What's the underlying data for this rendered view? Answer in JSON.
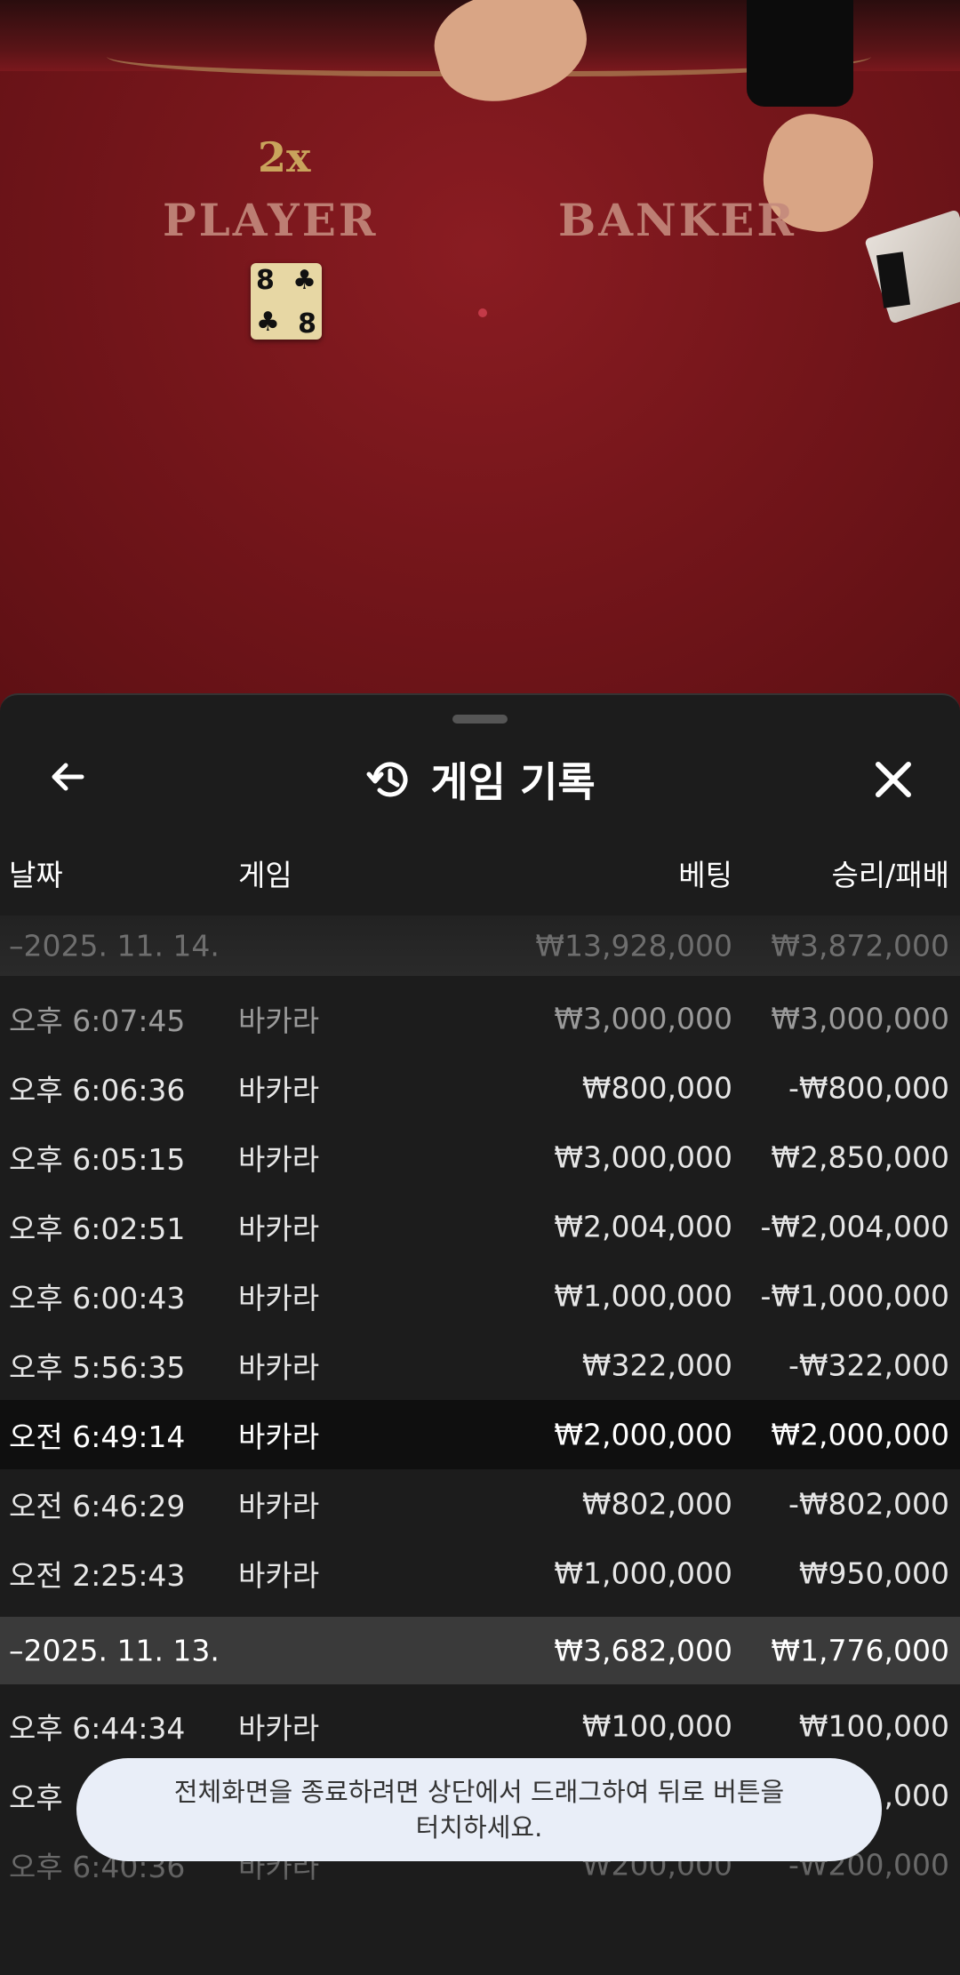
{
  "video": {
    "multiplier": "2x",
    "player_label": "PLAYER",
    "banker_label": "BANKER",
    "card": {
      "rank": "8",
      "suit": "♣"
    }
  },
  "sheet": {
    "title": "게임 기록",
    "icons": {
      "back": "back-arrow-icon",
      "title": "history-icon",
      "close": "close-icon"
    },
    "columns": {
      "date": "날짜",
      "game": "게임",
      "bet": "베팅",
      "win_loss": "승리/패배"
    },
    "groups": [
      {
        "date": "–2025. 11. 14.",
        "total_bet": "₩13,928,000",
        "total_wl": "₩3,872,000",
        "rows": [
          {
            "time": "오후 6:07:45",
            "game": "바카라",
            "bet": "₩3,000,000",
            "wl": "₩3,000,000"
          },
          {
            "time": "오후 6:06:36",
            "game": "바카라",
            "bet": "₩800,000",
            "wl": "-₩800,000"
          },
          {
            "time": "오후 6:05:15",
            "game": "바카라",
            "bet": "₩3,000,000",
            "wl": "₩2,850,000"
          },
          {
            "time": "오후 6:02:51",
            "game": "바카라",
            "bet": "₩2,004,000",
            "wl": "-₩2,004,000"
          },
          {
            "time": "오후 6:00:43",
            "game": "바카라",
            "bet": "₩1,000,000",
            "wl": "-₩1,000,000"
          },
          {
            "time": "오후 5:56:35",
            "game": "바카라",
            "bet": "₩322,000",
            "wl": "-₩322,000"
          },
          {
            "time": "오전 6:49:14",
            "game": "바카라",
            "bet": "₩2,000,000",
            "wl": "₩2,000,000"
          },
          {
            "time": "오전 6:46:29",
            "game": "바카라",
            "bet": "₩802,000",
            "wl": "-₩802,000"
          },
          {
            "time": "오전 2:25:43",
            "game": "바카라",
            "bet": "₩1,000,000",
            "wl": "₩950,000"
          }
        ]
      },
      {
        "date": "–2025. 11. 13.",
        "total_bet": "₩3,682,000",
        "total_wl": "₩1,776,000",
        "rows": [
          {
            "time": "오후 6:44:34",
            "game": "바카라",
            "bet": "₩100,000",
            "wl": "₩100,000"
          },
          {
            "time": "오후",
            "game": "",
            "bet": "",
            "wl": ",000"
          },
          {
            "time": "오후 6:40:36",
            "game": "바카라",
            "bet": "₩200,000",
            "wl": "-₩200,000"
          }
        ]
      }
    ]
  },
  "toast": {
    "line1": "전체화면을 종료하려면 상단에서 드래그하여 뒤로 버튼을",
    "line2": "터치하세요."
  },
  "colors": {
    "sheet_bg": "#1c1c1c",
    "highlight_row": "#0f0f0f",
    "group_header_bg": "#3a3a3a",
    "toast_bg": "#e9eef8",
    "felt": "#7a181d"
  }
}
